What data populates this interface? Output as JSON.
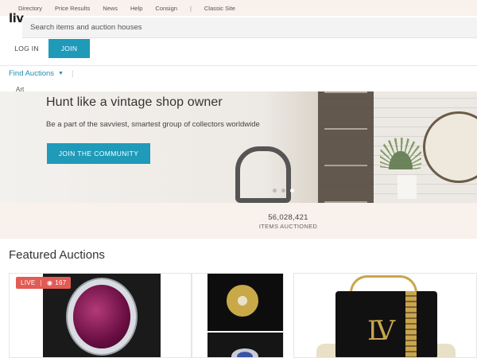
{
  "topnav": {
    "items": [
      "Directory",
      "Price Results",
      "News",
      "Help",
      "Consign"
    ],
    "separator": "|",
    "classic": "Classic Site"
  },
  "logo": "liv",
  "search": {
    "placeholder": "Search items and auction houses"
  },
  "auth": {
    "login": "LOG IN",
    "join": "JOIN"
  },
  "nav": {
    "find_auctions": "Find Auctions",
    "art": "Art"
  },
  "hero": {
    "title": "Hunt like a vintage shop owner",
    "subtitle": "Be a part of the savviest, smartest group of collectors worldwide",
    "cta": "JOIN THE COMMUNITY",
    "slides": 3,
    "active_slide": 3
  },
  "stats": {
    "number": "56,028,421",
    "label": "ITEMS AUCTIONED"
  },
  "featured": {
    "title": "Featured Auctions",
    "cards": [
      {
        "badge": "LIVE",
        "viewers": "167"
      }
    ]
  },
  "colors": {
    "accent": "#1f9ab9",
    "live": "#e25b54",
    "stats_bg": "#f8f1ec"
  }
}
